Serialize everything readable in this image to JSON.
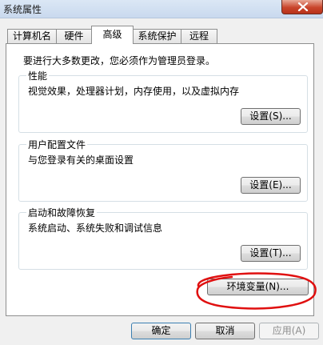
{
  "window": {
    "title": "系统属性"
  },
  "tabs": [
    {
      "label": "计算机名"
    },
    {
      "label": "硬件"
    },
    {
      "label": "高级"
    },
    {
      "label": "系统保护"
    },
    {
      "label": "远程"
    }
  ],
  "advanced": {
    "intro": "要进行大多数更改，您必须作为管理员登录。",
    "performance": {
      "title": "性能",
      "description": "视觉效果，处理器计划，内存使用，以及虚拟内存",
      "button": "设置(S)..."
    },
    "user_profiles": {
      "title": "用户配置文件",
      "description": "与您登录有关的桌面设置",
      "button": "设置(E)..."
    },
    "startup_recovery": {
      "title": "启动和故障恢复",
      "description": "系统启动、系统失败和调试信息",
      "button": "设置(T)..."
    },
    "env_vars_button": "环境变量(N)..."
  },
  "footer": {
    "ok": "确定",
    "cancel": "取消",
    "apply": "应用(A)"
  },
  "annotation": {
    "color": "#e01010"
  }
}
